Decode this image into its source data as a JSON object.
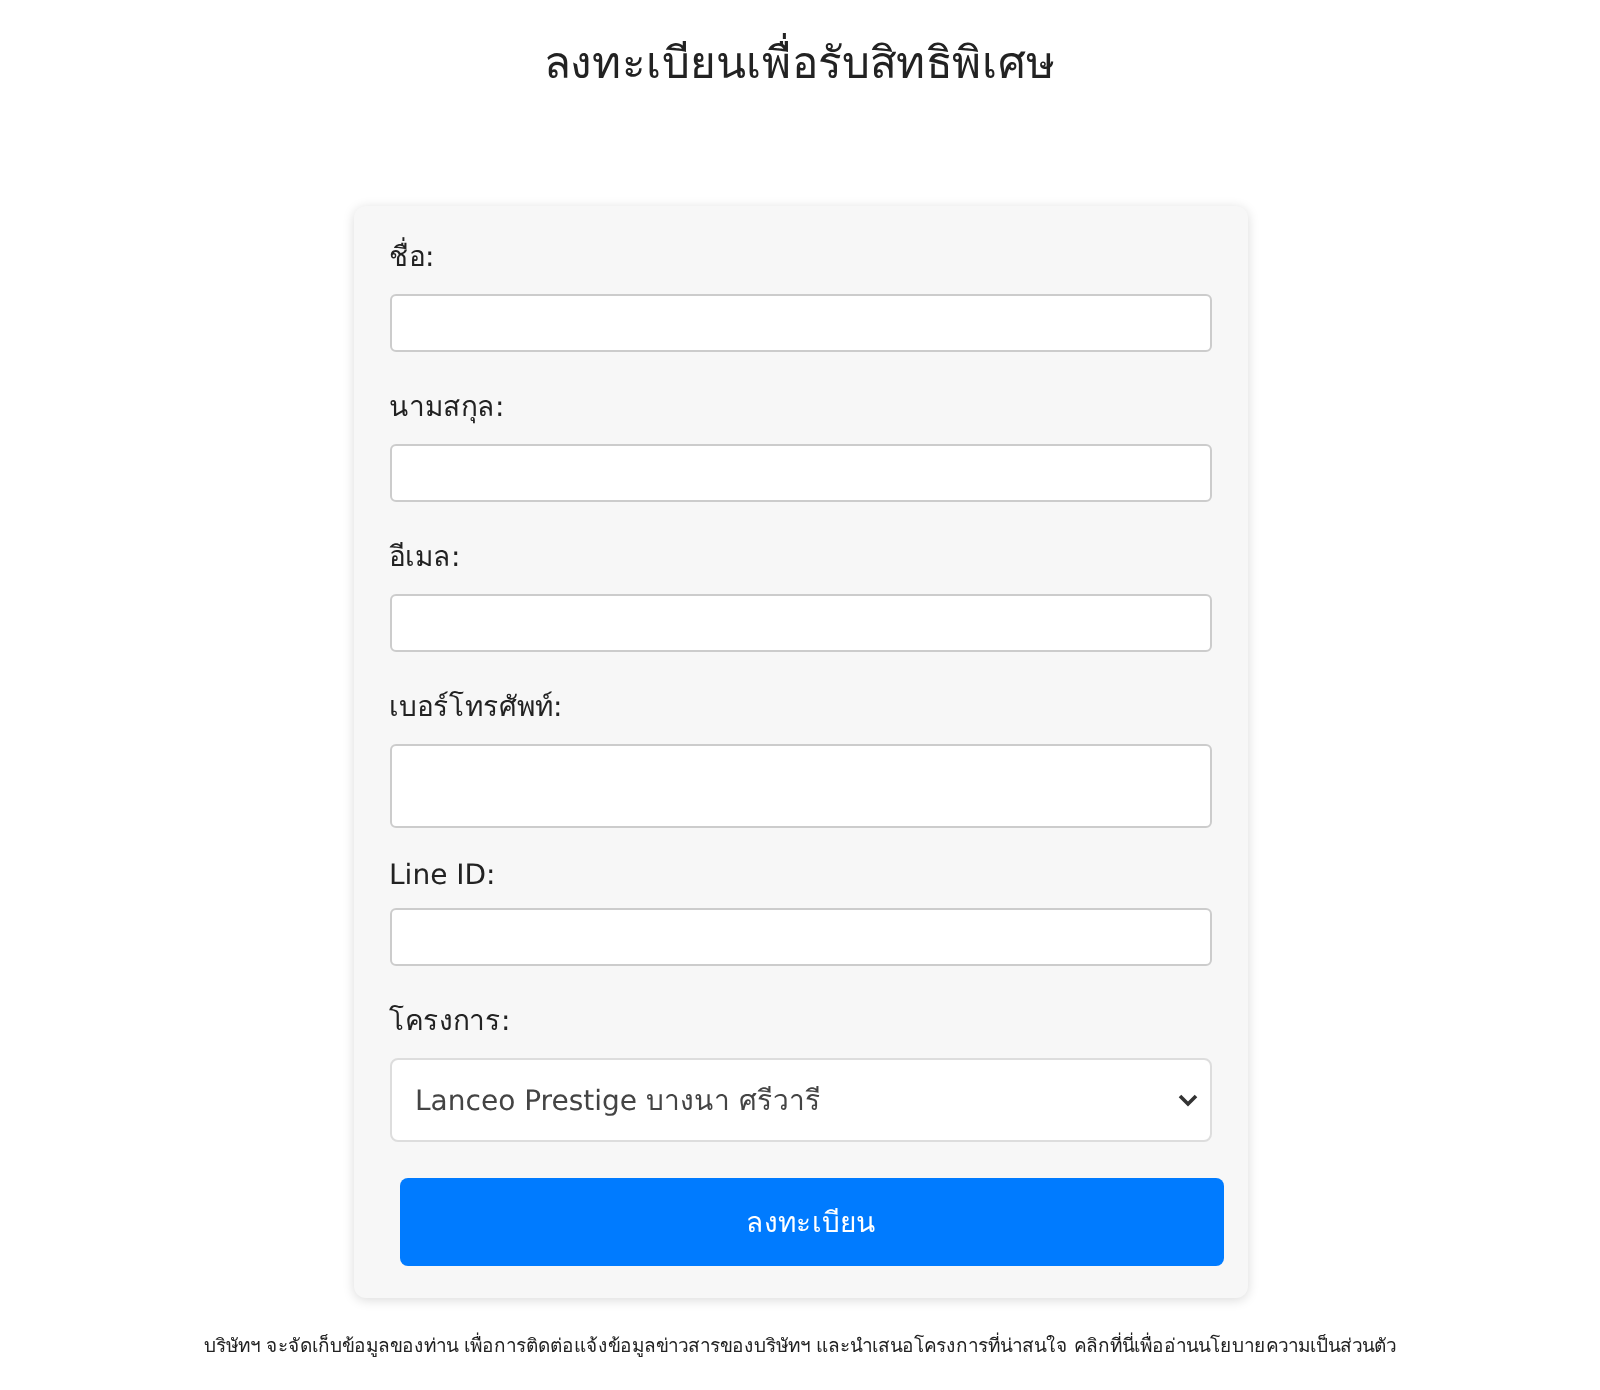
{
  "title": "ลงทะเบียนเพื่อรับสิทธิพิเศษ",
  "fields": [
    {
      "kind": "text",
      "label": "ชื่อ:"
    },
    {
      "kind": "text",
      "label": "นามสกุล:"
    },
    {
      "kind": "text",
      "label": "อีเมล:"
    },
    {
      "kind": "tall",
      "label": "เบอร์โทรศัพท์:"
    },
    {
      "kind": "text",
      "label": "Line ID:"
    },
    {
      "kind": "select",
      "label": "โครงการ:",
      "value": "Lanceo Prestige บางนา ศรีวารี"
    }
  ],
  "submit": "ลงทะเบียน",
  "notice": {
    "text": "บริษัทฯ จะจัดเก็บข้อมูลของท่าน เพื่อการติดต่อแจ้งข้อมูลข่าวสารของบริษัทฯ และนำเสนอโครงการที่น่าสนใจ",
    "link": "คลิกที่นี่เพื่ออ่านนโยบายความเป็นส่วนตัว"
  }
}
